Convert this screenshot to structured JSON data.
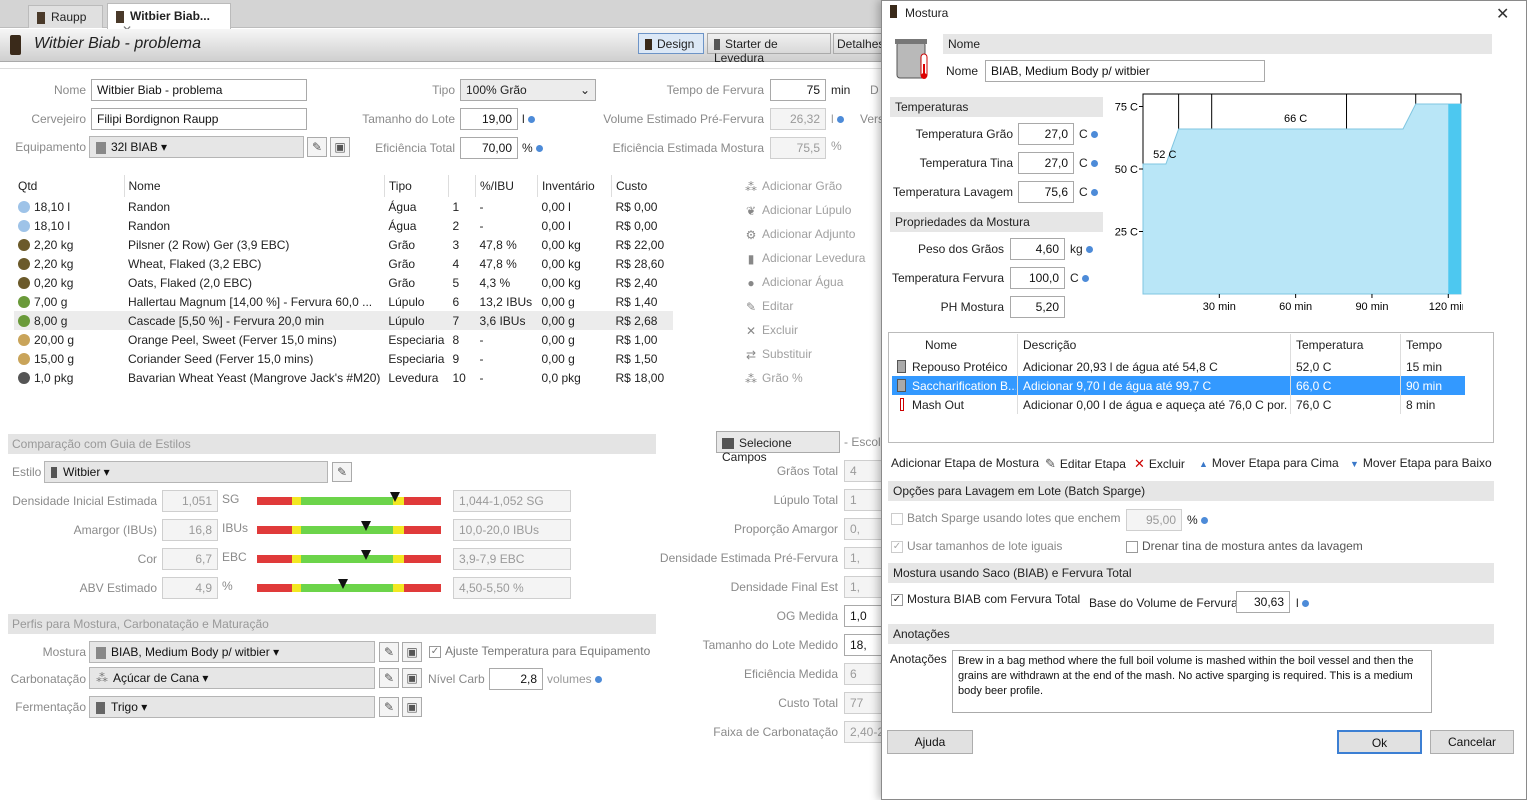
{
  "tabs": [
    {
      "label": "Raupp"
    },
    {
      "label": "Witbier Biab..."
    }
  ],
  "title": "Witbier Biab - problema",
  "toolbar": {
    "design": "Design",
    "starter": "Starter de Levedura",
    "detalhes": "Detalhes"
  },
  "fields": {
    "nome_l": "Nome",
    "nome": "Witbier Biab - problema",
    "cervejeiro_l": "Cervejeiro",
    "cervejeiro": "Filipi Bordignon Raupp",
    "equip_l": "Equipamento",
    "equip": "32l BIAB",
    "tipo_l": "Tipo",
    "tipo": "100% Grão",
    "lote_l": "Tamanho do Lote",
    "lote": "19,00",
    "lote_u": "l",
    "efic_l": "Eficiência Total",
    "efic": "70,00",
    "efic_u": "%",
    "ferv_l": "Tempo de Fervura",
    "ferv": "75",
    "ferv_u": "min",
    "vol_l": "Volume Estimado Pré-Fervura",
    "vol": "26,32",
    "vol_u": "l",
    "efm_l": "Eficiência Estimada Mostura",
    "efm": "75,5",
    "efm_u": "%",
    "d_l": "D",
    "vers_l": "Vers"
  },
  "ingredients": {
    "headers": [
      "Qtd",
      "Nome",
      "Tipo",
      "%/IBU",
      "Inventário",
      "Custo"
    ],
    "rows": [
      {
        "qtd": "18,10 l",
        "nome": "Randon",
        "tipo": "Água",
        "n": "1",
        "pct": "-",
        "inv": "0,00 l",
        "custo": "R$ 0,00",
        "k": "agua"
      },
      {
        "qtd": "18,10 l",
        "nome": "Randon",
        "tipo": "Água",
        "n": "2",
        "pct": "-",
        "inv": "0,00 l",
        "custo": "R$ 0,00",
        "k": "agua"
      },
      {
        "qtd": "2,20 kg",
        "nome": "Pilsner (2 Row) Ger (3,9 EBC)",
        "tipo": "Grão",
        "n": "3",
        "pct": "47,8 %",
        "inv": "0,00 kg",
        "custo": "R$ 22,00",
        "k": "grao"
      },
      {
        "qtd": "2,20 kg",
        "nome": "Wheat, Flaked (3,2 EBC)",
        "tipo": "Grão",
        "n": "4",
        "pct": "47,8 %",
        "inv": "0,00 kg",
        "custo": "R$ 28,60",
        "k": "grao"
      },
      {
        "qtd": "0,20 kg",
        "nome": "Oats, Flaked (2,0 EBC)",
        "tipo": "Grão",
        "n": "5",
        "pct": "4,3 %",
        "inv": "0,00 kg",
        "custo": "R$ 2,40",
        "k": "grao"
      },
      {
        "qtd": "7,00 g",
        "nome": "Hallertau Magnum [14,00 %] - Fervura 60,0 ...",
        "tipo": "Lúpulo",
        "n": "6",
        "pct": "13,2 IBUs",
        "inv": "0,00 g",
        "custo": "R$ 1,40",
        "k": "lupulo"
      },
      {
        "qtd": "8,00 g",
        "nome": "Cascade [5,50 %] - Fervura 20,0 min",
        "tipo": "Lúpulo",
        "n": "7",
        "pct": "3,6 IBUs",
        "inv": "0,00 g",
        "custo": "R$ 2,68",
        "k": "lupulo"
      },
      {
        "qtd": "20,00 g",
        "nome": "Orange Peel, Sweet (Ferver 15,0 mins)",
        "tipo": "Especiaria",
        "n": "8",
        "pct": "-",
        "inv": "0,00 g",
        "custo": "R$ 1,00",
        "k": "esp"
      },
      {
        "qtd": "15,00 g",
        "nome": "Coriander Seed (Ferver 15,0 mins)",
        "tipo": "Especiaria",
        "n": "9",
        "pct": "-",
        "inv": "0,00 g",
        "custo": "R$ 1,50",
        "k": "esp"
      },
      {
        "qtd": "1,0 pkg",
        "nome": "Bavarian Wheat Yeast (Mangrove Jack's #M20)",
        "tipo": "Levedura",
        "n": "10",
        "pct": "-",
        "inv": "0,0 pkg",
        "custo": "R$ 18,00",
        "k": "lev"
      }
    ]
  },
  "actions": [
    "Adicionar Grão",
    "Adicionar Lúpulo",
    "Adicionar Adjunto",
    "Adicionar Levedura",
    "Adicionar Água",
    "Editar",
    "Excluir",
    "Substituir",
    "Grão %"
  ],
  "styles": {
    "section": "Comparação com Guia de Estilos",
    "estilo_l": "Estilo",
    "estilo": "Witbier",
    "rows": [
      {
        "label": "Densidade Inicial Estimada",
        "val": "1,051",
        "unit": "SG",
        "range": "1,044-1,052 SG",
        "pos": 0.75
      },
      {
        "label": "Amargor (IBUs)",
        "val": "16,8",
        "unit": "IBUs",
        "range": "10,0-20,0 IBUs",
        "pos": 0.59
      },
      {
        "label": "Cor",
        "val": "6,7",
        "unit": "EBC",
        "range": "3,9-7,9 EBC",
        "pos": 0.59
      },
      {
        "label": "ABV Estimado",
        "val": "4,9",
        "unit": "%",
        "range": "4,50-5,50 %",
        "pos": 0.47
      }
    ]
  },
  "profiles": {
    "section": "Perfis para Mostura, Carbonatação e Maturação",
    "mostura_l": "Mostura",
    "mostura": "BIAB, Medium Body p/ witbier",
    "ajuste": "Ajuste Temperatura para Equipamento",
    "carb_l": "Carbonatação",
    "carb": "Açúcar de Cana",
    "nivel_l": "Nível Carb",
    "nivel": "2,8",
    "nivel_u": "volumes",
    "ferm_l": "Fermentação",
    "ferm": "Trigo"
  },
  "selecione": "Selecione Campos",
  "escolh": "- Escoll",
  "summary": [
    "Grãos Total",
    "Lúpulo Total",
    "Proporção Amargor",
    "Densidade Estimada Pré-Fervura",
    "Densidade Final Est",
    "OG Medida",
    "Tamanho do Lote Medido",
    "Eficiência Medida",
    "Custo Total",
    "Faixa de Carbonatação"
  ],
  "summary_vals": [
    "4",
    "1",
    "0,",
    "1,",
    "1,",
    "1,0",
    "18,",
    "6",
    "77",
    "2,40-2,"
  ],
  "dialog": {
    "title": "Mostura",
    "nome_sec": "Nome",
    "nome_l": "Nome",
    "nome": "BIAB, Medium Body p/ witbier",
    "temp_sec": "Temperaturas",
    "tgrao_l": "Temperatura Grão",
    "tgrao": "27,0",
    "ttina_l": "Temperatura Tina",
    "ttina": "27,0",
    "tlav_l": "Temperatura Lavagem",
    "tlav": "75,6",
    "c": "C",
    "prop_sec": "Propriedades da Mostura",
    "peso_l": "Peso dos Grãos",
    "peso": "4,60",
    "peso_u": "kg",
    "tferv_l": "Temperatura Fervura",
    "tferv": "100,0",
    "ph_l": "PH Mostura",
    "ph": "5,20",
    "steps_headers": [
      "Nome",
      "Descrição",
      "Temperatura",
      "Tempo"
    ],
    "steps": [
      {
        "nome": "Repouso Protéico",
        "desc": "Adicionar 20,93 l de água até 54,8 C",
        "temp": "52,0 C",
        "tempo": "15 min"
      },
      {
        "nome": "Saccharification B...",
        "desc": "Adicionar 9,70 l de água até 99,7 C",
        "temp": "66,0 C",
        "tempo": "90 min"
      },
      {
        "nome": "Mash Out",
        "desc": "Adicionar 0,00 l de água e aqueça até 76,0 C por...",
        "temp": "76,0 C",
        "tempo": "8 min"
      }
    ],
    "step_actions": [
      "Adicionar Etapa de Mostura",
      "Editar Etapa",
      "Excluir",
      "Mover Etapa para Cima",
      "Mover Etapa para Baixo"
    ],
    "batch_sec": "Opções para Lavagem em Lote (Batch Sparge)",
    "batch_cb": "Batch Sparge usando lotes que enchem",
    "batch_val": "95,00",
    "batch_u": "%",
    "iguais": "Usar tamanhos de lote iguais",
    "drenar": "Drenar tina de mostura antes da lavagem",
    "biab_sec": "Mostura usando Saco (BIAB) e Fervura Total",
    "biab_cb": "Mostura BIAB com Fervura Total",
    "base_l": "Base do Volume de Fervura",
    "base": "30,63",
    "base_u": "l",
    "anot_sec": "Anotações",
    "anot_l": "Anotações",
    "anot": "Brew in a bag method where the full boil volume is mashed within the boil vessel and then the grains are withdrawn at the end of the mash.  No active sparging is required. This is a medium body beer profile.",
    "ajuda": "Ajuda",
    "ok": "Ok",
    "cancelar": "Cancelar"
  },
  "chart_data": {
    "type": "area",
    "x_ticks": [
      "30 min",
      "60 min",
      "90 min",
      "120 min"
    ],
    "y_ticks": [
      "25 C",
      "50 C",
      "75 C"
    ],
    "annotations": [
      "52 C",
      "66 C"
    ],
    "steps": [
      {
        "temp": 52,
        "minutes": 15
      },
      {
        "temp": 66,
        "minutes": 90
      },
      {
        "temp": 76,
        "minutes": 8
      }
    ],
    "xlim": [
      0,
      125
    ],
    "ylim": [
      0,
      80
    ]
  }
}
